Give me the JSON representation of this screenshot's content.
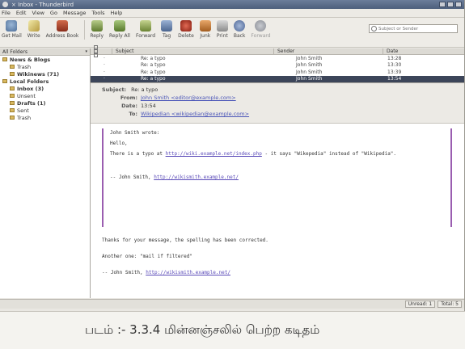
{
  "window": {
    "title": "× Inbox - Thunderbird"
  },
  "menu": [
    "File",
    "Edit",
    "View",
    "Go",
    "Message",
    "Tools",
    "Help"
  ],
  "toolbar": {
    "buttons": [
      {
        "label": "Get Mail",
        "icon": "get-mail-icon"
      },
      {
        "label": "Write",
        "icon": "write-icon"
      },
      {
        "label": "Address Book",
        "icon": "address-book-icon"
      },
      {
        "label": "Reply",
        "icon": "reply-icon"
      },
      {
        "label": "Reply All",
        "icon": "reply-all-icon"
      },
      {
        "label": "Forward",
        "icon": "forward-icon"
      },
      {
        "label": "Tag",
        "icon": "tag-icon"
      },
      {
        "label": "Delete",
        "icon": "delete-icon"
      },
      {
        "label": "Junk",
        "icon": "junk-icon"
      },
      {
        "label": "Print",
        "icon": "print-icon"
      },
      {
        "label": "Back",
        "icon": "back-icon"
      },
      {
        "label": "Forward",
        "icon": "forward-nav-icon"
      }
    ],
    "search_placeholder": "Subject or Sender"
  },
  "folders": {
    "header": "All Folders",
    "items": [
      {
        "label": "News & Blogs",
        "bold": true,
        "indent": 0
      },
      {
        "label": "Trash",
        "bold": false,
        "indent": 1
      },
      {
        "label": "Wikinews (71)",
        "bold": true,
        "indent": 1
      },
      {
        "label": "Local Folders",
        "bold": true,
        "indent": 0
      },
      {
        "label": "Inbox (3)",
        "bold": true,
        "indent": 1
      },
      {
        "label": "Unsent",
        "bold": false,
        "indent": 1
      },
      {
        "label": "Drafts (1)",
        "bold": true,
        "indent": 1
      },
      {
        "label": "Sent",
        "bold": false,
        "indent": 1
      },
      {
        "label": "Trash",
        "bold": false,
        "indent": 1
      }
    ]
  },
  "threads": {
    "columns": {
      "subject": "Subject",
      "sender": "Sender",
      "date": "Date"
    },
    "rows": [
      {
        "subject": "Re: a typo",
        "sender": "John Smith",
        "date": "13:28",
        "selected": false
      },
      {
        "subject": "Re: a typo",
        "sender": "John Smith",
        "date": "13:30",
        "selected": false
      },
      {
        "subject": "Re: a typo",
        "sender": "John Smith",
        "date": "13:39",
        "selected": false
      },
      {
        "subject": "Re: a typo",
        "sender": "John Smith",
        "date": "13:54",
        "selected": true
      }
    ]
  },
  "message": {
    "subject_label": "Subject:",
    "subject": "Re: a typo",
    "from_label": "From:",
    "from": "John Smith <editor@example.com>",
    "date_label": "Date:",
    "date": "13:54",
    "to_label": "To:",
    "to": "Wikipedian <wikipedian@example.com>",
    "quote_intro": "John Smith wrote:",
    "quote_hello": "Hello,",
    "quote_text_a": "There is a typo at ",
    "quote_link": "http://wiki.example.net/index.php",
    "quote_text_b": " - it says \"Wikepedia\" instead of \"Wikipedia\".",
    "quote_sig_prefix": "-- John Smith, ",
    "quote_sig_link": "http://wikismith.example.net/",
    "body_line1": "Thanks for your message, the spelling has been corrected.",
    "body_line2": "Another one: \"mail if filtered\"",
    "sig_prefix": "-- John Smith, ",
    "sig_link": "http://wikismith.example.net/"
  },
  "status": {
    "unread": "Unread: 1",
    "total": "Total: 5"
  },
  "caption": "படம் :-  3.3.4 மின்னஞ்சலில் பெற்ற கடிதம்"
}
